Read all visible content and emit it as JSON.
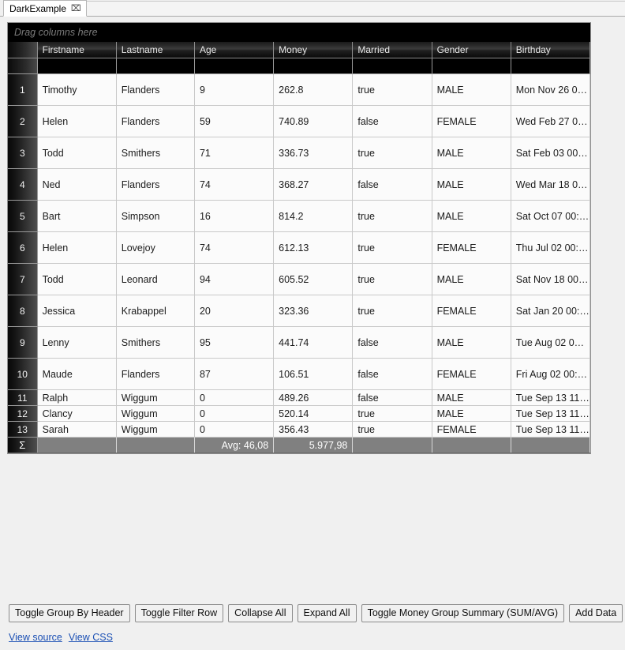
{
  "window": {
    "tab": {
      "label": "DarkExample",
      "close_icon": "⌧"
    }
  },
  "grid": {
    "group_panel_text": "Drag columns here",
    "row_header_label": "",
    "summary_symbol": "Σ",
    "columns": [
      {
        "key": "firstname",
        "label": "Firstname"
      },
      {
        "key": "lastname",
        "label": "Lastname"
      },
      {
        "key": "age",
        "label": "Age"
      },
      {
        "key": "money",
        "label": "Money"
      },
      {
        "key": "married",
        "label": "Married"
      },
      {
        "key": "gender",
        "label": "Gender"
      },
      {
        "key": "birthday",
        "label": "Birthday"
      }
    ],
    "filter_values": [
      "",
      "",
      "",
      "",
      "",
      "",
      ""
    ],
    "rows": [
      {
        "n": "1",
        "firstname": "Timothy",
        "lastname": "Flanders",
        "age": "9",
        "money": "262.8",
        "married": "true",
        "gender": "MALE",
        "birthday": "Mon Nov 26 0…"
      },
      {
        "n": "2",
        "firstname": "Helen",
        "lastname": "Flanders",
        "age": "59",
        "money": "740.89",
        "married": "false",
        "gender": "FEMALE",
        "birthday": "Wed Feb 27 00:…"
      },
      {
        "n": "3",
        "firstname": "Todd",
        "lastname": "Smithers",
        "age": "71",
        "money": "336.73",
        "married": "true",
        "gender": "MALE",
        "birthday": "Sat Feb 03 00:0…"
      },
      {
        "n": "4",
        "firstname": "Ned",
        "lastname": "Flanders",
        "age": "74",
        "money": "368.27",
        "married": "false",
        "gender": "MALE",
        "birthday": "Wed Mar 18 00…"
      },
      {
        "n": "5",
        "firstname": "Bart",
        "lastname": "Simpson",
        "age": "16",
        "money": "814.2",
        "married": "true",
        "gender": "MALE",
        "birthday": "Sat Oct 07 00:0…"
      },
      {
        "n": "6",
        "firstname": "Helen",
        "lastname": "Lovejoy",
        "age": "74",
        "money": "612.13",
        "married": "true",
        "gender": "FEMALE",
        "birthday": "Thu Jul 02 00:0…"
      },
      {
        "n": "7",
        "firstname": "Todd",
        "lastname": "Leonard",
        "age": "94",
        "money": "605.52",
        "married": "true",
        "gender": "MALE",
        "birthday": "Sat Nov 18 00:…"
      },
      {
        "n": "8",
        "firstname": "Jessica",
        "lastname": "Krabappel",
        "age": "20",
        "money": "323.36",
        "married": "true",
        "gender": "FEMALE",
        "birthday": "Sat Jan 20 00:0…"
      },
      {
        "n": "9",
        "firstname": "Lenny",
        "lastname": "Smithers",
        "age": "95",
        "money": "441.74",
        "married": "false",
        "gender": "MALE",
        "birthday": "Tue Aug 02 00:…"
      },
      {
        "n": "10",
        "firstname": "Maude",
        "lastname": "Flanders",
        "age": "87",
        "money": "106.51",
        "married": "false",
        "gender": "FEMALE",
        "birthday": "Fri Aug 02 00:0…"
      },
      {
        "n": "11",
        "firstname": "Ralph",
        "lastname": "Wiggum",
        "age": "0",
        "money": "489.26",
        "married": "false",
        "gender": "MALE",
        "birthday": "Tue Sep 13 11:…"
      },
      {
        "n": "12",
        "firstname": "Clancy",
        "lastname": "Wiggum",
        "age": "0",
        "money": "520.14",
        "married": "true",
        "gender": "MALE",
        "birthday": "Tue Sep 13 11:…"
      },
      {
        "n": "13",
        "firstname": "Sarah",
        "lastname": "Wiggum",
        "age": "0",
        "money": "356.43",
        "married": "true",
        "gender": "FEMALE",
        "birthday": "Tue Sep 13 11:…"
      }
    ],
    "summary": {
      "firstname": "",
      "lastname": "",
      "age": "Avg: 46,08",
      "money": "5.977,98",
      "married": "",
      "gender": "",
      "birthday": ""
    }
  },
  "buttons": [
    {
      "id": "toggle-group-by-header",
      "label": "Toggle Group By Header"
    },
    {
      "id": "toggle-filter-row",
      "label": "Toggle Filter Row"
    },
    {
      "id": "collapse-all",
      "label": "Collapse All"
    },
    {
      "id": "expand-all",
      "label": "Expand All"
    },
    {
      "id": "toggle-money-group-summary",
      "label": "Toggle Money Group Summary (SUM/AVG)"
    },
    {
      "id": "add-data",
      "label": "Add Data"
    }
  ],
  "links": [
    {
      "id": "view-source",
      "label": "View source"
    },
    {
      "id": "view-css",
      "label": "View CSS"
    }
  ],
  "colors": {
    "grid_background": "#000000",
    "row_background": "#fbfbfb",
    "summary_background": "#808080",
    "page_background": "#f0f0f0",
    "link": "#1a4fb4"
  }
}
